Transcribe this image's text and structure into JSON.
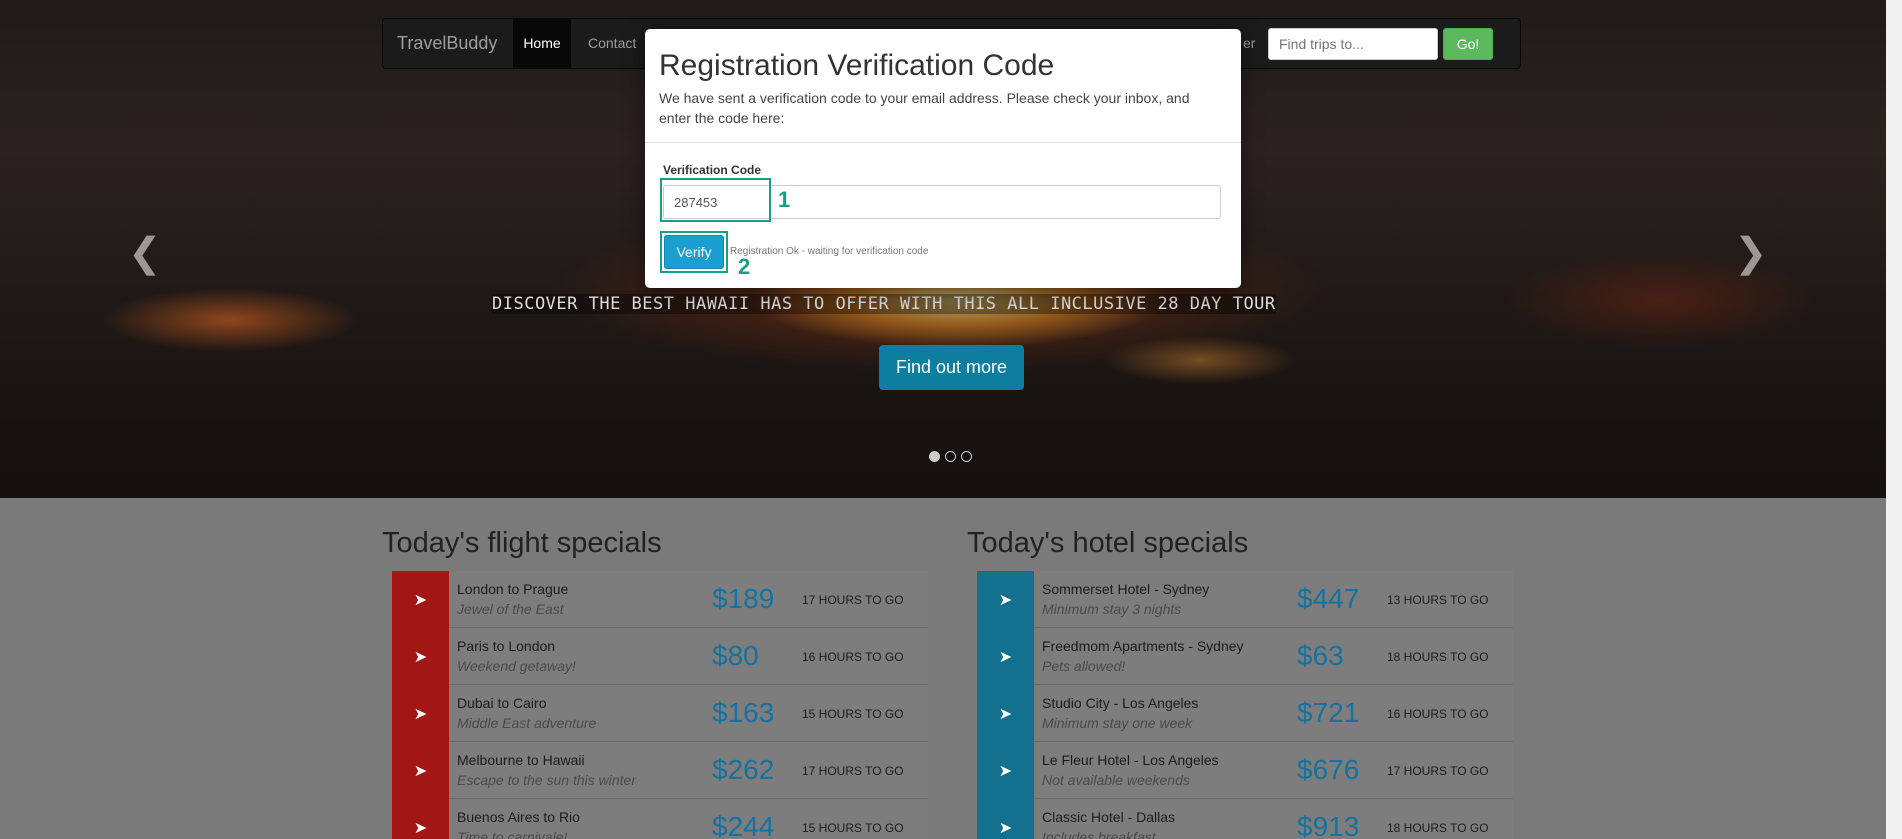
{
  "navbar": {
    "brand": "TravelBuddy",
    "home": "Home",
    "contact": "Contact",
    "right_fragment": "er",
    "search_placeholder": "Find trips to...",
    "go": "Go!"
  },
  "hero": {
    "caption": "DISCOVER THE BEST HAWAII HAS TO OFFER WITH THIS ALL INCLUSIVE 28 DAY TOUR",
    "cta": "Find out more",
    "prev_icon": "chevron-left-icon",
    "next_icon": "chevron-right-icon",
    "slides": 3,
    "active_slide": 1
  },
  "flights": {
    "title": "Today's flight specials",
    "items": [
      {
        "name": "London to Prague",
        "sub": "Jewel of the East",
        "price": "$189",
        "time": "17 HOURS TO GO"
      },
      {
        "name": "Paris to London",
        "sub": "Weekend getaway!",
        "price": "$80",
        "time": "16 HOURS TO GO"
      },
      {
        "name": "Dubai to Cairo",
        "sub": "Middle East adventure",
        "price": "$163",
        "time": "15 HOURS TO GO"
      },
      {
        "name": "Melbourne to Hawaii",
        "sub": "Escape to the sun this winter",
        "price": "$262",
        "time": "17 HOURS TO GO"
      },
      {
        "name": "Buenos Aires to Rio",
        "sub": "Time to carnivale!",
        "price": "$244",
        "time": "15 HOURS TO GO"
      }
    ]
  },
  "hotels": {
    "title": "Today's hotel specials",
    "items": [
      {
        "name": "Sommerset Hotel - Sydney",
        "sub": "Minimum stay 3 nights",
        "price": "$447",
        "time": "13 HOURS TO GO"
      },
      {
        "name": "Freedmom Apartments - Sydney",
        "sub": "Pets allowed!",
        "price": "$63",
        "time": "18 HOURS TO GO"
      },
      {
        "name": "Studio City - Los Angeles",
        "sub": "Minimum stay one week",
        "price": "$721",
        "time": "16 HOURS TO GO"
      },
      {
        "name": "Le Fleur Hotel - Los Angeles",
        "sub": "Not available weekends",
        "price": "$676",
        "time": "17 HOURS TO GO"
      },
      {
        "name": "Classic Hotel - Dallas",
        "sub": "Includes breakfast",
        "price": "$913",
        "time": "18 HOURS TO GO"
      }
    ]
  },
  "modal": {
    "title": "Registration Verification Code",
    "description": "We have sent a verification code to your email address. Please check your inbox, and enter the code here:",
    "field_label": "Verification Code",
    "code_value": "287453",
    "verify": "Verify",
    "status": "Registration Ok - waiting for verification code",
    "annotation_1": "1",
    "annotation_2": "2"
  },
  "colors": {
    "accent": "#16a08a",
    "flight_icon_bg": "#a31616",
    "hotel_icon_bg": "#14708f",
    "price": "#1472a0"
  }
}
